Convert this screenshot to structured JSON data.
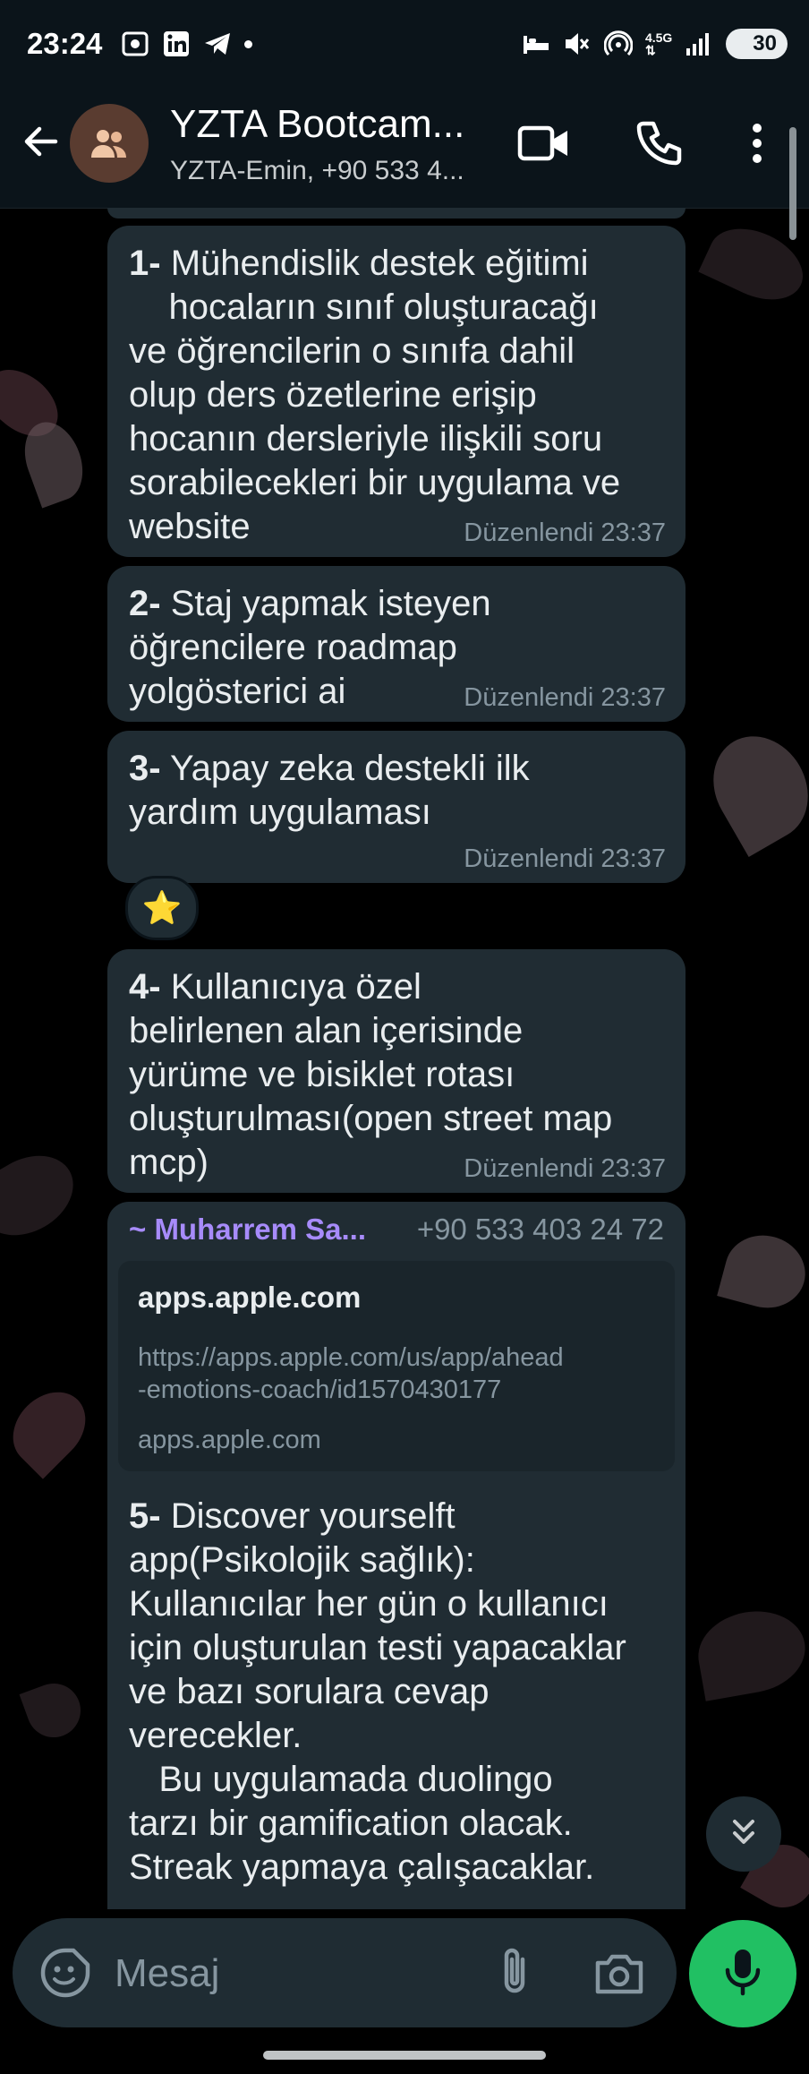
{
  "status_bar": {
    "time": "23:24",
    "battery": "30",
    "icons": [
      "screenshot-icon",
      "linkedin-icon",
      "telegram-icon",
      "dot-icon",
      "bed-icon",
      "mute-icon",
      "hotspot-icon",
      "network-4-5g-icon",
      "signal-icon",
      "battery-icon"
    ]
  },
  "header": {
    "title": "YZTA Bootcam...",
    "subtitle": "YZTA-Emin, +90 533 4...",
    "icons": [
      "back-arrow-icon",
      "group-avatar-icon",
      "video-call-icon",
      "phone-call-icon",
      "more-vert-icon"
    ]
  },
  "messages": [
    {
      "number": "1-",
      "text": " Mühendislik destek eğitimi\n    hocaların sınıf oluşturacağı\nve öğrencilerin o sınıfa dahil\nolup ders özetlerine erişip\nhocanın dersleriyle ilişkili soru\nsorabilecekleri bir uygulama ve\nwebsite",
      "meta": "Düzenlendi 23:37"
    },
    {
      "number": "2-",
      "text": " Staj yapmak isteyen\nöğrencilere roadmap\nyolgösterici ai",
      "meta": "Düzenlendi 23:37"
    },
    {
      "number": "3-",
      "text": " Yapay zeka destekli ilk\nyardım uygulaması",
      "meta": "Düzenlendi 23:37",
      "reaction": "⭐"
    },
    {
      "number": "4-",
      "text": " Kullanıcıya özel\nbelirlenen alan içerisinde\nyürüme ve bisiklet rotası\noluşturulması(open street map\nmcp)",
      "meta": "Düzenlendi 23:37"
    },
    {
      "sender": "~ Muharrem Sa...",
      "sender_phone": "+90 533 403 24 72",
      "link_preview": {
        "title": "apps.apple.com",
        "url": "https://apps.apple.com/us/app/ahead\n-emotions-coach/id1570430177",
        "domain": "apps.apple.com"
      },
      "number": "5-",
      "text": " Discover yourselft\napp(Psikolojik sağlık):\nKullanıcılar her gün o kullanıcı\niçin oluşturulan testi yapacaklar\nve bazı sorulara cevap\nverecekler.\n   Bu uygulamada duolingo\ntarzı bir gamification olacak.\nStreak yapmaya çalışacaklar."
    }
  ],
  "composer": {
    "placeholder": "Mesaj",
    "icons": [
      "emoji-sticker-icon",
      "attach-icon",
      "camera-icon",
      "mic-icon",
      "scroll-down-icon"
    ]
  },
  "colors": {
    "header_bg": "#0b141a",
    "bubble_bg": "#202c33",
    "sender_name": "#a78bfa",
    "meta_text": "#8696a0",
    "mic_button": "#21c063"
  }
}
